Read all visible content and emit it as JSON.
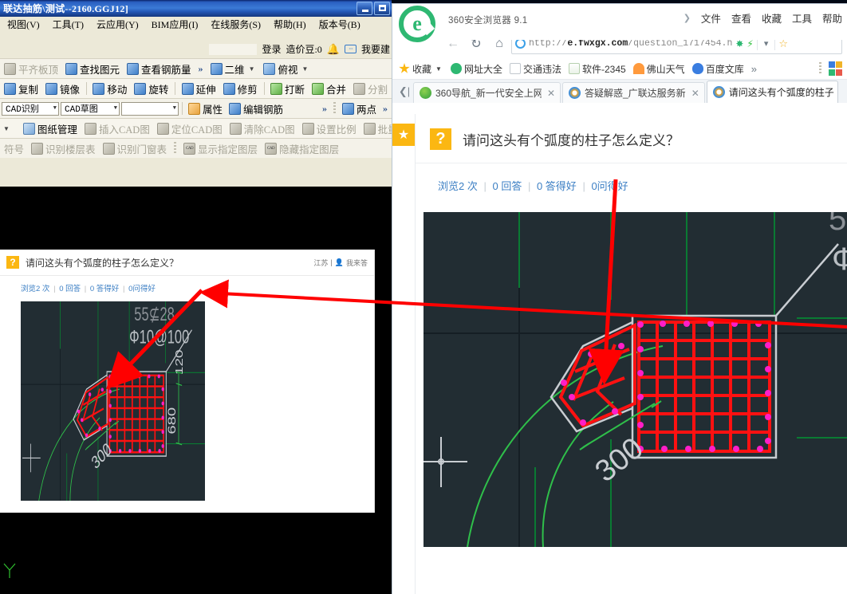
{
  "cad_app": {
    "window_title": "联达抽筋\\测试--2160.GGJ12]",
    "window_buttons": {
      "minimize": "minimize-button",
      "maximize": "maximize-button"
    },
    "menu": [
      {
        "label": "视图(V)"
      },
      {
        "label": "工具(T)"
      },
      {
        "label": "云应用(Y)"
      },
      {
        "label": "BIM应用(I)"
      },
      {
        "label": "在线服务(S)"
      },
      {
        "label": "帮助(H)"
      },
      {
        "label": "版本号(B)"
      }
    ],
    "account_bar": {
      "login": "登录",
      "coins": "造价豆:0",
      "suggest": "我要建"
    },
    "toolbar_row1": [
      {
        "label": "平齐板顶",
        "disabled": true
      },
      {
        "label": "查找图元",
        "disabled": false
      },
      {
        "label": "查看钢筋量",
        "disabled": false
      }
    ],
    "toolbar_row1_right": [
      {
        "label": "二维",
        "dropdown": true
      },
      {
        "label": "俯视",
        "dropdown": true
      }
    ],
    "toolbar_row2": [
      {
        "label": "复制",
        "disabled": false
      },
      {
        "label": "镜像",
        "disabled": false
      },
      {
        "label": "移动",
        "disabled": false
      },
      {
        "label": "旋转",
        "disabled": false
      },
      {
        "label": "延伸",
        "disabled": false
      },
      {
        "label": "修剪",
        "disabled": false
      },
      {
        "label": "打断",
        "disabled": false
      },
      {
        "label": "合并",
        "disabled": false
      },
      {
        "label": "分割",
        "disabled": true
      }
    ],
    "toolbar_row3": {
      "combo1": "CAD识别",
      "combo2": "CAD草图",
      "combo3": "",
      "items": [
        {
          "label": "属性"
        },
        {
          "label": "编辑钢筋"
        }
      ],
      "right_item": "两点"
    },
    "toolbar_row4": [
      {
        "label": "图纸管理",
        "disabled": false
      },
      {
        "label": "插入CAD图",
        "disabled": true
      },
      {
        "label": "定位CAD图",
        "disabled": true
      },
      {
        "label": "清除CAD图",
        "disabled": true
      },
      {
        "label": "设置比例",
        "disabled": true
      },
      {
        "label": "批量替换",
        "disabled": true
      }
    ],
    "toolbar_row5": [
      {
        "label": "符号",
        "disabled": true
      },
      {
        "label": "识别楼层表",
        "disabled": true
      },
      {
        "label": "识别门窗表",
        "disabled": true
      },
      {
        "label": "显示指定图层",
        "disabled": true
      },
      {
        "label": "隐藏指定图层",
        "disabled": true
      }
    ]
  },
  "mini_page": {
    "question_title": "请问这头有个弧度的柱子怎么定义？",
    "region": "江苏",
    "author": "我来答",
    "stats": {
      "views": "浏览2 次",
      "answers": "0 回答",
      "good_answers": "0 答得好",
      "good_questions": "0问得好"
    }
  },
  "browser": {
    "app_name": "360安全浏览器",
    "version": "9.1",
    "menus": [
      "文件",
      "查看",
      "收藏",
      "工具",
      "帮助"
    ],
    "address": {
      "scheme": "http://",
      "host": "e.fwxgx.com",
      "path": "/question_1717454.h"
    },
    "bookmarks": [
      {
        "label": "收藏",
        "icon": "star-icon",
        "dropdown": true
      },
      {
        "label": "网址大全",
        "icon": "globe-icon"
      },
      {
        "label": "交通违法",
        "icon": "page-icon"
      },
      {
        "label": "软件-2345",
        "icon": "house-icon"
      },
      {
        "label": "佛山天气",
        "icon": "sun-icon"
      },
      {
        "label": "百度文库",
        "icon": "paw-icon"
      },
      {
        "label": "»",
        "icon": "more-icon"
      }
    ],
    "tabs": [
      {
        "label": "360导航_新一代安全上网",
        "favicon": "360-icon",
        "active": false,
        "closable": true
      },
      {
        "label": "答疑解惑_广联达服务新",
        "favicon": "ie-icon",
        "active": false,
        "closable": true
      },
      {
        "label": "请问这头有个弧度的柱子",
        "favicon": "ie-icon",
        "active": true,
        "closable": false
      }
    ]
  },
  "page": {
    "question_title": "请问这头有个弧度的柱子怎么定义？",
    "stats": {
      "views": "浏览2 次",
      "answers": "0 回答",
      "good_answers": "0 答得好",
      "good_questions": "0问得好"
    }
  },
  "drawing": {
    "labels": {
      "rebar_main": "55⊈28",
      "rebar_stirrup": "Ф10@100",
      "dim_120": "120",
      "dim_680": "680",
      "dim_300": "300"
    },
    "colors": {
      "background": "#222d33",
      "rebar": "#ff0000",
      "node": "#ff00c8",
      "grid": "#00a651",
      "outline": "#c9cdd2"
    }
  },
  "annotations": {
    "arrow_color": "#ff0000",
    "arrows": [
      {
        "name": "arrow-to-column-in-browser"
      },
      {
        "name": "arrow-from-browser-to-cad"
      },
      {
        "name": "arrow-to-cad-column"
      }
    ]
  }
}
